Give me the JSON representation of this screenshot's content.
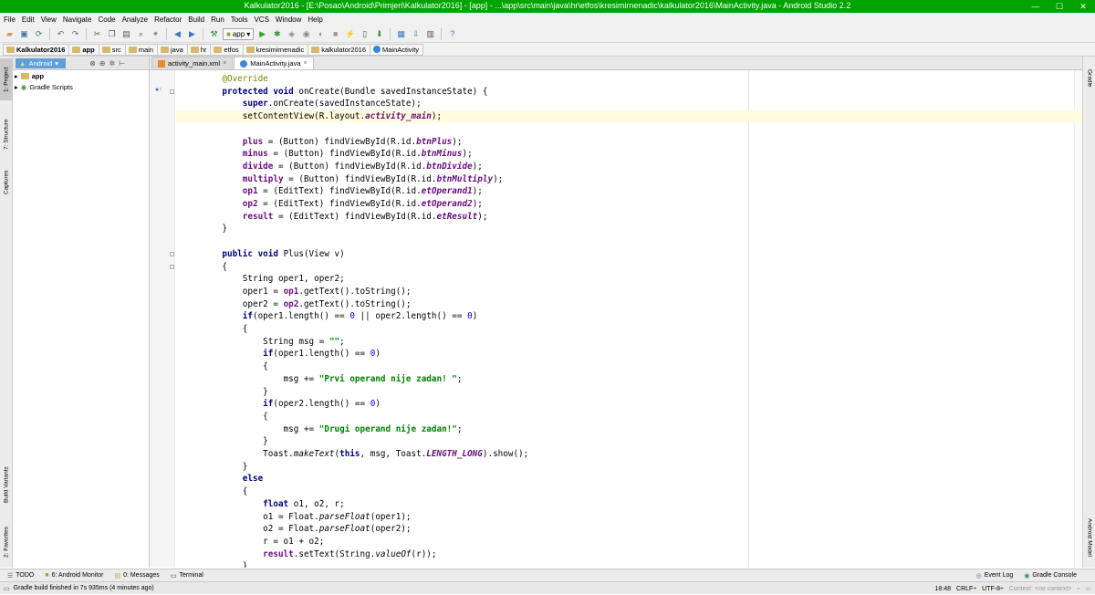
{
  "window": {
    "title": "Kalkulator2016 - [E:\\Posao\\Android\\Primjeri\\Kalkulator2016] - [app] - ...\\app\\src\\main\\java\\hr\\etfos\\kresimirnenadic\\kalkulator2016\\MainActivity.java - Android Studio 2.2",
    "minimize": "—",
    "maximize": "☐",
    "close": "✕"
  },
  "menu": [
    "File",
    "Edit",
    "View",
    "Navigate",
    "Code",
    "Analyze",
    "Refactor",
    "Build",
    "Run",
    "Tools",
    "VCS",
    "Window",
    "Help"
  ],
  "toolbar": {
    "run_config": "app"
  },
  "breadcrumbs": [
    "Kalkulator2016",
    "app",
    "src",
    "main",
    "java",
    "hr",
    "etfos",
    "kresimirnenadic",
    "kalkulator2016",
    "MainActivity"
  ],
  "project": {
    "view_selector": "Android",
    "items": [
      "app",
      "Gradle Scripts"
    ]
  },
  "left_tool_windows": [
    "1: Project",
    "7: Structure",
    "Captures",
    "Build Variants",
    "2: Favorites"
  ],
  "right_tool_windows": [
    "Gradle",
    "Android Model"
  ],
  "tabs": [
    {
      "label": "activity_main.xml",
      "active": false
    },
    {
      "label": "MainActivity.java",
      "active": true
    }
  ],
  "code_lines": [
    [
      {
        "t": "    "
      },
      {
        "c": "an",
        "t": "@Override"
      }
    ],
    [
      {
        "t": "    "
      },
      {
        "c": "k",
        "t": "protected void "
      },
      {
        "t": "onCreate(Bundle savedInstanceState) {"
      }
    ],
    [
      {
        "t": "        "
      },
      {
        "c": "k",
        "t": "super"
      },
      {
        "t": ".onCreate(savedInstanceState);"
      }
    ],
    [
      {
        "t": "        setContentView(R.layout."
      },
      {
        "c": "it",
        "t": "activity_main"
      },
      {
        "t": ");"
      }
    ],
    [
      {
        "t": ""
      }
    ],
    [
      {
        "t": "        "
      },
      {
        "c": "f",
        "t": "plus"
      },
      {
        "t": " = (Button) findViewById(R.id."
      },
      {
        "c": "it",
        "t": "btnPlus"
      },
      {
        "t": ");"
      }
    ],
    [
      {
        "t": "        "
      },
      {
        "c": "f",
        "t": "minus"
      },
      {
        "t": " = (Button) findViewById(R.id."
      },
      {
        "c": "it",
        "t": "btnMinus"
      },
      {
        "t": ");"
      }
    ],
    [
      {
        "t": "        "
      },
      {
        "c": "f",
        "t": "divide"
      },
      {
        "t": " = (Button) findViewById(R.id."
      },
      {
        "c": "it",
        "t": "btnDivide"
      },
      {
        "t": ");"
      }
    ],
    [
      {
        "t": "        "
      },
      {
        "c": "f",
        "t": "multiply"
      },
      {
        "t": " = (Button) findViewById(R.id."
      },
      {
        "c": "it",
        "t": "btnMultiply"
      },
      {
        "t": ");"
      }
    ],
    [
      {
        "t": "        "
      },
      {
        "c": "f",
        "t": "op1"
      },
      {
        "t": " = (EditText) findViewById(R.id."
      },
      {
        "c": "it",
        "t": "etOperand1"
      },
      {
        "t": ");"
      }
    ],
    [
      {
        "t": "        "
      },
      {
        "c": "f",
        "t": "op2"
      },
      {
        "t": " = (EditText) findViewById(R.id."
      },
      {
        "c": "it",
        "t": "etOperand2"
      },
      {
        "t": ");"
      }
    ],
    [
      {
        "t": "        "
      },
      {
        "c": "f",
        "t": "result"
      },
      {
        "t": " = (EditText) findViewById(R.id."
      },
      {
        "c": "it",
        "t": "etResult"
      },
      {
        "t": ");"
      }
    ],
    [
      {
        "t": "    }"
      }
    ],
    [
      {
        "t": ""
      }
    ],
    [
      {
        "t": "    "
      },
      {
        "c": "k",
        "t": "public void "
      },
      {
        "t": "Plus(View v)"
      }
    ],
    [
      {
        "t": "    {"
      }
    ],
    [
      {
        "t": "        String oper1, oper2;"
      }
    ],
    [
      {
        "t": "        oper1 = "
      },
      {
        "c": "f",
        "t": "op1"
      },
      {
        "t": ".getText().toString();"
      }
    ],
    [
      {
        "t": "        oper2 = "
      },
      {
        "c": "f",
        "t": "op2"
      },
      {
        "t": ".getText().toString();"
      }
    ],
    [
      {
        "t": "        "
      },
      {
        "c": "k",
        "t": "if"
      },
      {
        "t": "(oper1.length() == "
      },
      {
        "c": "n",
        "t": "0"
      },
      {
        "t": " || oper2.length() == "
      },
      {
        "c": "n",
        "t": "0"
      },
      {
        "t": ")"
      }
    ],
    [
      {
        "t": "        {"
      }
    ],
    [
      {
        "t": "            String msg = "
      },
      {
        "c": "s",
        "t": "\"\""
      },
      {
        "t": ";"
      }
    ],
    [
      {
        "t": "            "
      },
      {
        "c": "k",
        "t": "if"
      },
      {
        "t": "(oper1.length() == "
      },
      {
        "c": "n",
        "t": "0"
      },
      {
        "t": ")"
      }
    ],
    [
      {
        "t": "            {"
      }
    ],
    [
      {
        "t": "                msg += "
      },
      {
        "c": "s",
        "t": "\"Prvi operand nije zadan! \""
      },
      {
        "t": ";"
      }
    ],
    [
      {
        "t": "            }"
      }
    ],
    [
      {
        "t": "            "
      },
      {
        "c": "k",
        "t": "if"
      },
      {
        "t": "(oper2.length() == "
      },
      {
        "c": "n",
        "t": "0"
      },
      {
        "t": ")"
      }
    ],
    [
      {
        "t": "            {"
      }
    ],
    [
      {
        "t": "                msg += "
      },
      {
        "c": "s",
        "t": "\"Drugi operand nije zadan!\""
      },
      {
        "t": ";"
      }
    ],
    [
      {
        "t": "            }"
      }
    ],
    [
      {
        "t": "            Toast."
      },
      {
        "c": "sm",
        "t": "makeText"
      },
      {
        "t": "("
      },
      {
        "c": "k",
        "t": "this"
      },
      {
        "t": ", msg, Toast."
      },
      {
        "c": "it",
        "t": "LENGTH_LONG"
      },
      {
        "t": ").show();"
      }
    ],
    [
      {
        "t": "        }"
      }
    ],
    [
      {
        "t": "        "
      },
      {
        "c": "k",
        "t": "else"
      }
    ],
    [
      {
        "t": "        {"
      }
    ],
    [
      {
        "t": "            "
      },
      {
        "c": "k",
        "t": "float "
      },
      {
        "t": "o1, o2, r;"
      }
    ],
    [
      {
        "t": "            o1 = Float."
      },
      {
        "c": "sm",
        "t": "parseFloat"
      },
      {
        "t": "(oper1);"
      }
    ],
    [
      {
        "t": "            o2 = Float."
      },
      {
        "c": "sm",
        "t": "parseFloat"
      },
      {
        "t": "(oper2);"
      }
    ],
    [
      {
        "t": "            r = o1 + o2;"
      }
    ],
    [
      {
        "t": "            "
      },
      {
        "c": "f",
        "t": "result"
      },
      {
        "t": ".setText(String."
      },
      {
        "c": "sm",
        "t": "valueOf"
      },
      {
        "t": "(r));"
      }
    ],
    [
      {
        "t": "        }"
      }
    ]
  ],
  "bottom_tool_windows": [
    "TODO",
    "6: Android Monitor",
    "0: Messages",
    "Terminal"
  ],
  "bottom_right_tools": [
    "Event Log",
    "Gradle Console"
  ],
  "status": {
    "message": "Gradle build finished in 7s 935ms (4 minutes ago)",
    "position": "18:48",
    "line_sep": "CRLF÷",
    "encoding": "UTF-8÷",
    "context": "Context: <no context>"
  },
  "colors": {
    "titlebar": "#00a300",
    "keyword": "#000080",
    "field": "#660e7a",
    "string": "#008000",
    "number": "#0000ff",
    "annotation": "#808000",
    "caret_line": "#fffce0"
  }
}
